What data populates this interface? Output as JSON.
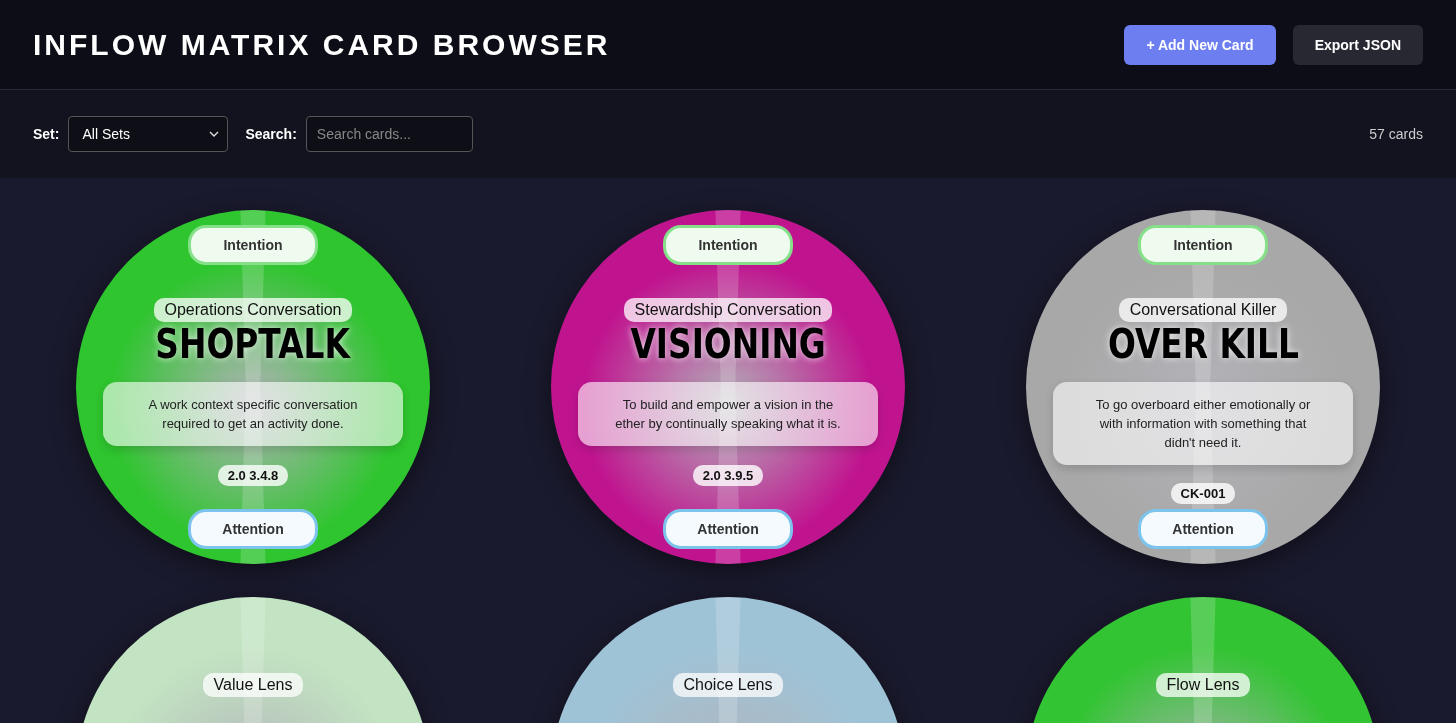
{
  "header": {
    "title": "INFLOW MATRIX CARD BROWSER",
    "buttons": [
      {
        "label": "+ Add New Card",
        "kind": "primary"
      },
      {
        "label": "Export JSON",
        "kind": "secondary"
      }
    ]
  },
  "filters": {
    "set_label": "Set:",
    "set_value": "All Sets",
    "search_label": "Search:",
    "search_placeholder": "Search cards...",
    "count": "57 cards"
  },
  "cards": [
    {
      "kind": "conversation",
      "color": "#2ec52e",
      "top": "Intention",
      "category": "Operations Conversation",
      "title": "SHOPTALK",
      "description": "A work context specific conversation required to get an activity done.",
      "code": "2.0 3.4.8",
      "bottom": "Attention"
    },
    {
      "kind": "conversation",
      "color": "#c0148f",
      "top": "Intention",
      "category": "Stewardship Conversation",
      "title": "VISIONING",
      "description": "To build and empower a vision in the ether by continually speaking what it is.",
      "code": "2.0 3.9.5",
      "bottom": "Attention"
    },
    {
      "kind": "killer",
      "color": "#a8a8a8",
      "top": "Intention",
      "category": "Conversational Killer",
      "title": "OVER KILL",
      "description": "To go overboard either emotionally or with information with something that didn't need it.",
      "code": "CK-001",
      "bottom": "Attention"
    },
    {
      "kind": "lens",
      "color": "#c2e4c2",
      "category": "Value Lens"
    },
    {
      "kind": "lens",
      "color": "#9fc3d6",
      "category": "Choice Lens"
    },
    {
      "kind": "lens",
      "color": "#33c433",
      "category": "Flow Lens"
    }
  ]
}
